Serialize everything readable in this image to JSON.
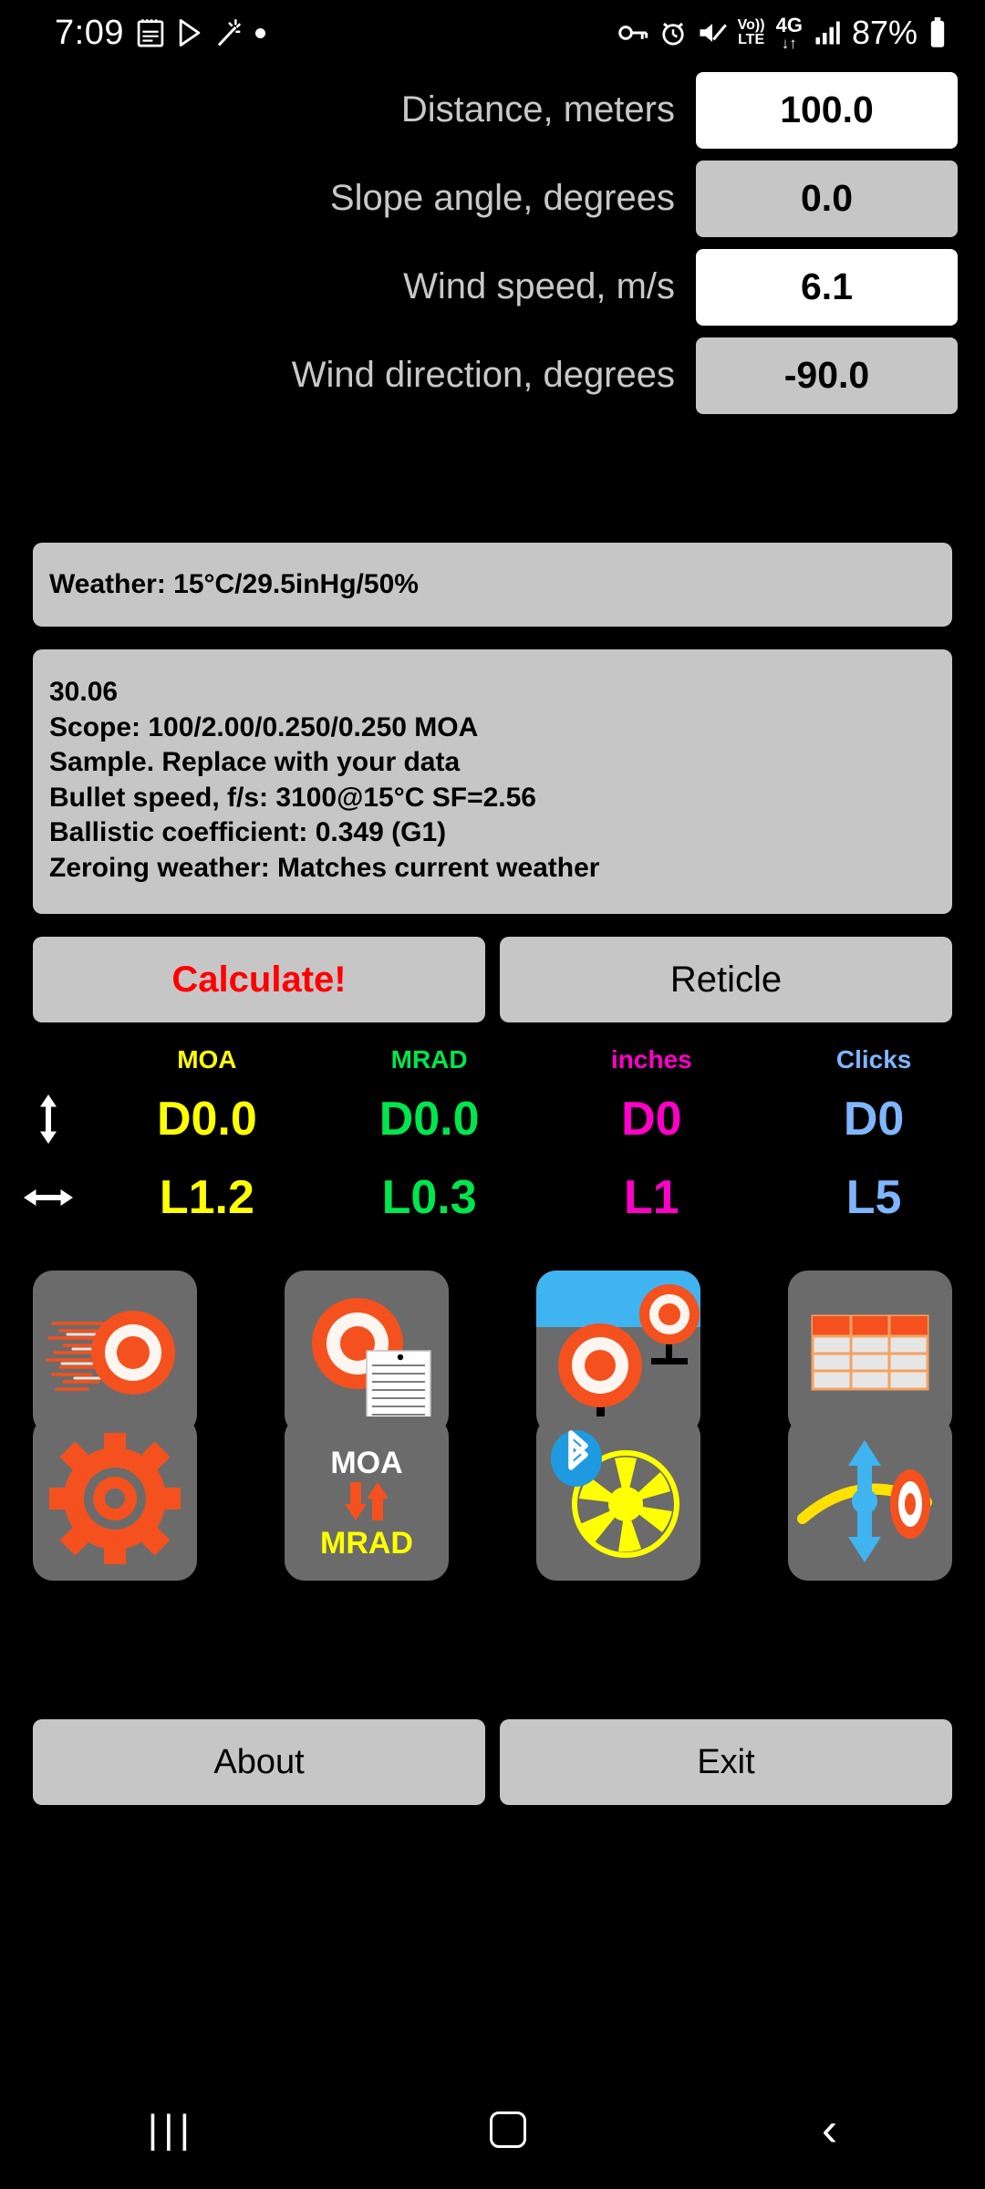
{
  "statusbar": {
    "time": "7:09",
    "battery_text": "87%",
    "left_icons": [
      "calendar-icon",
      "play-store-icon",
      "magic-wand-icon",
      "dot-icon"
    ],
    "right_icons": [
      "vpn-key-icon",
      "alarm-icon",
      "mute-icon",
      "volte-icon",
      "4g-icon",
      "signal-icon",
      "battery-icon"
    ],
    "volte_top": "Vo))",
    "volte_bottom": "LTE",
    "net_label": "4G",
    "net_arrows": "↓↑"
  },
  "inputs": [
    {
      "label": "Distance, meters",
      "value": "100.0",
      "style": "white",
      "name": "distance"
    },
    {
      "label": "Slope angle, degrees",
      "value": "0.0",
      "style": "gray",
      "name": "slope-angle"
    },
    {
      "label": "Wind speed, m/s",
      "value": "6.1",
      "style": "white",
      "name": "wind-speed"
    },
    {
      "label": "Wind direction, degrees",
      "value": "-90.0",
      "style": "gray",
      "name": "wind-direction"
    }
  ],
  "weather": {
    "text": "Weather: 15°C/29.5inHg/50%"
  },
  "profile": {
    "lines": [
      "30.06",
      "Scope: 100/2.00/0.250/0.250 MOA",
      "Sample. Replace with your data",
      "Bullet speed, f/s: 3100@15°C SF=2.56",
      "Ballistic coefficient: 0.349 (G1)",
      "Zeroing weather: Matches current weather"
    ]
  },
  "action_buttons": {
    "calculate": "Calculate!",
    "reticle": "Reticle"
  },
  "results": {
    "headers": [
      {
        "label": "MOA",
        "color": "#ffff00"
      },
      {
        "label": "MRAD",
        "color": "#00e64d"
      },
      {
        "label": "inches",
        "color": "#ff00c8"
      },
      {
        "label": "Clicks",
        "color": "#7eb6ff"
      }
    ],
    "rows": [
      {
        "arrow": "vertical-arrow-icon",
        "cells": [
          {
            "value": "D0.0",
            "color": "#ffff00"
          },
          {
            "value": "D0.0",
            "color": "#00e64d"
          },
          {
            "value": "D0",
            "color": "#ff00c8"
          },
          {
            "value": "D0",
            "color": "#7eb6ff"
          }
        ]
      },
      {
        "arrow": "horizontal-arrow-icon",
        "cells": [
          {
            "value": "L1.2",
            "color": "#ffff00"
          },
          {
            "value": "L0.3",
            "color": "#00e64d"
          },
          {
            "value": "L1",
            "color": "#ff00c8"
          },
          {
            "value": "L5",
            "color": "#7eb6ff"
          }
        ]
      }
    ]
  },
  "icons": {
    "row1": [
      {
        "name": "bullet-trajectory-target-icon"
      },
      {
        "name": "target-report-icon"
      },
      {
        "name": "multi-target-range-icon"
      },
      {
        "name": "ballistic-table-icon"
      }
    ],
    "row2": [
      {
        "name": "settings-gear-icon"
      },
      {
        "name": "moa-mrad-converter-icon",
        "top_label": "MOA",
        "bottom_label": "MRAD"
      },
      {
        "name": "bluetooth-anemometer-icon"
      },
      {
        "name": "trajectory-adjust-icon"
      }
    ]
  },
  "bottom_buttons": {
    "about": "About",
    "exit": "Exit"
  },
  "navbar": {
    "recents": "|||",
    "home": "home-icon",
    "back": "‹"
  },
  "colors": {
    "background": "#000000",
    "panel": "#c6c6c6",
    "field_active": "#ffffff",
    "tile": "#6b6b6b",
    "accent_orange": "#f4511e",
    "calculate_red": "#ff0000"
  }
}
